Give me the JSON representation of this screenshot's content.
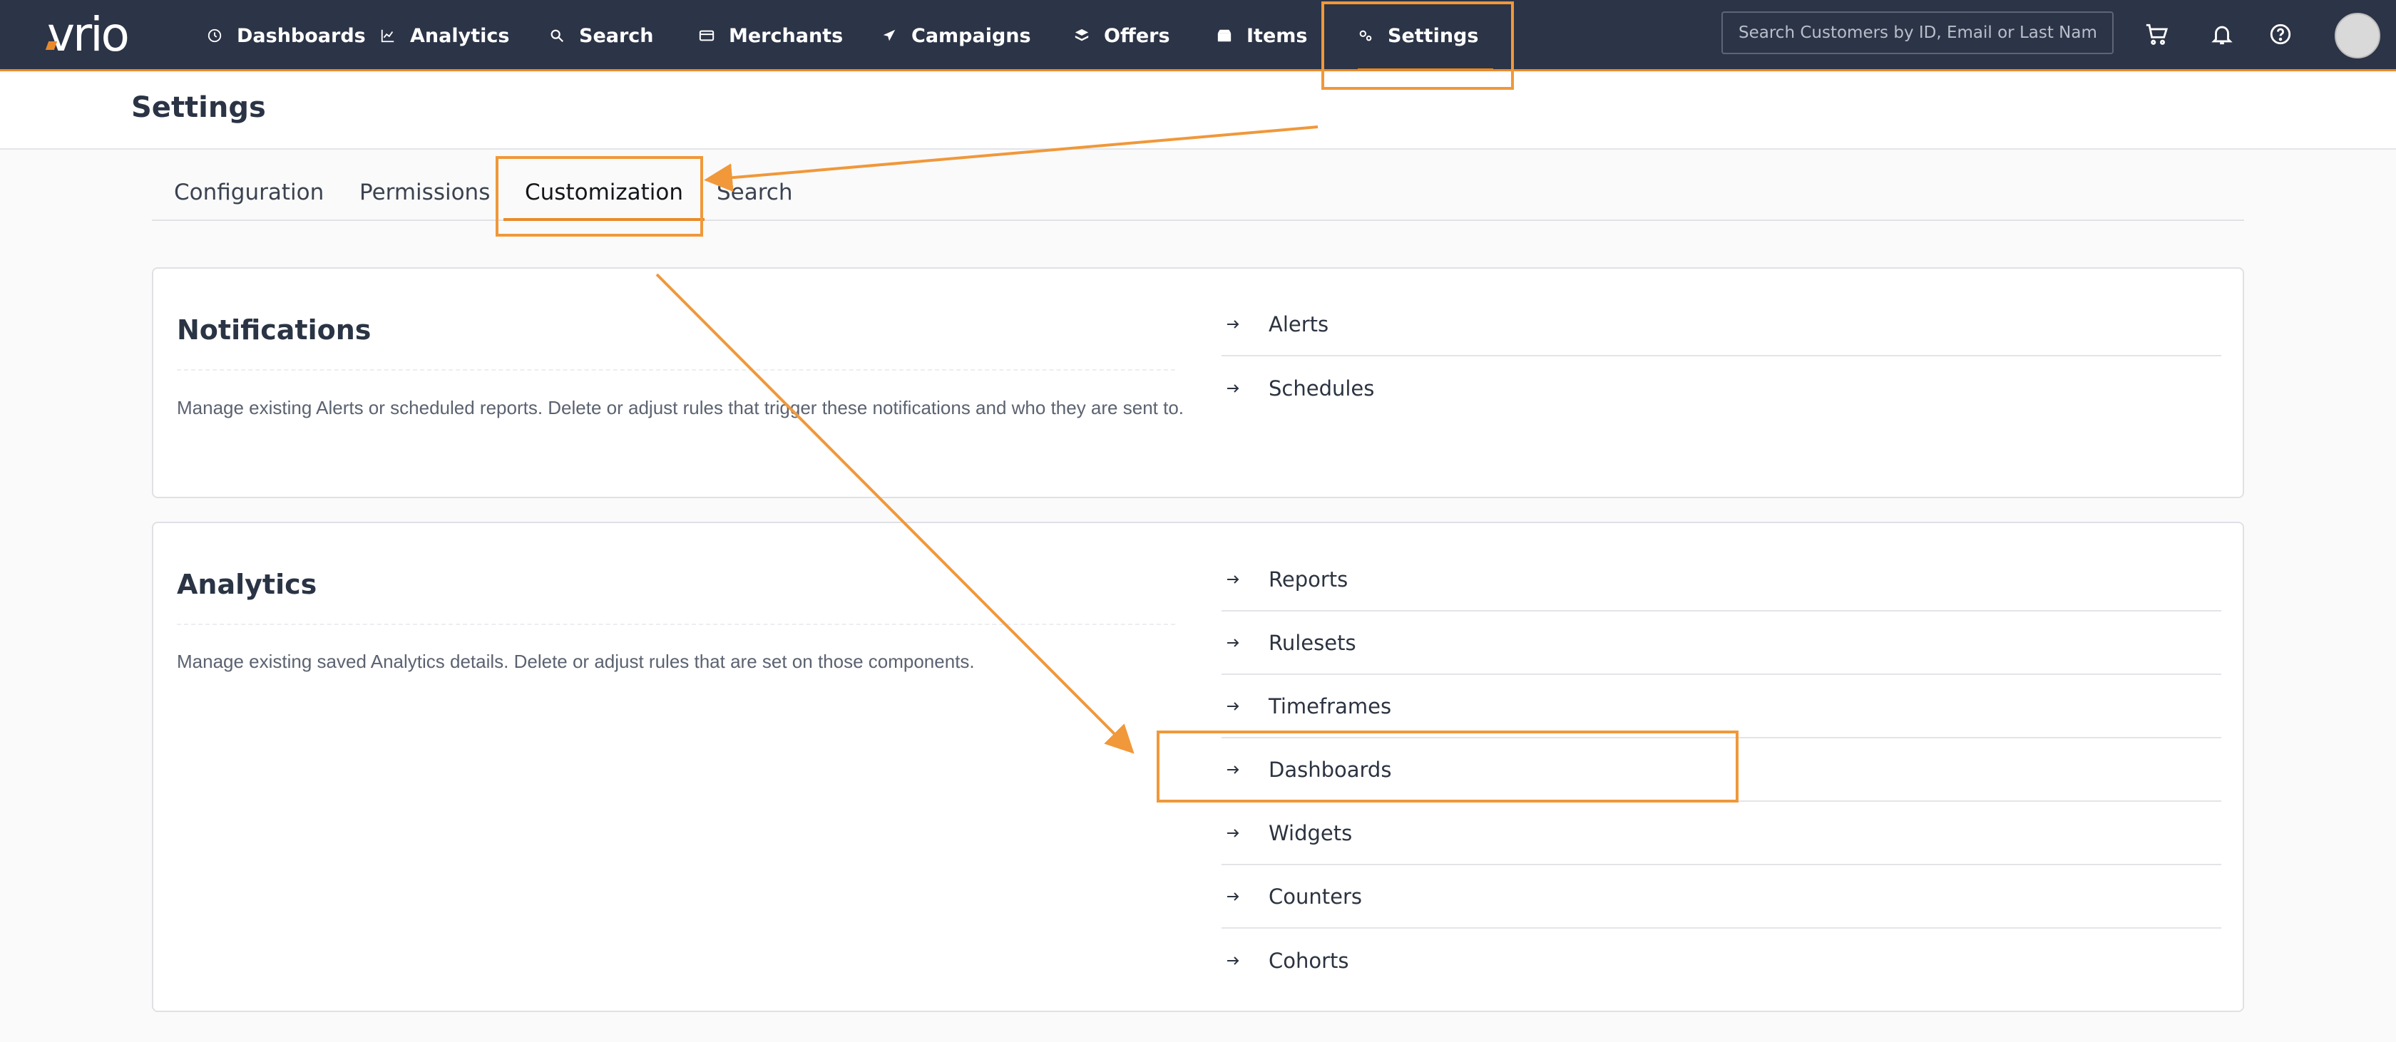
{
  "app": {
    "logo_text": "vrio"
  },
  "nav": {
    "items": [
      {
        "label": "Dashboards",
        "icon": "dashboard-icon"
      },
      {
        "label": "Analytics",
        "icon": "chart-icon"
      },
      {
        "label": "Search",
        "icon": "search-icon"
      },
      {
        "label": "Merchants",
        "icon": "credit-card-icon"
      },
      {
        "label": "Campaigns",
        "icon": "paper-plane-icon"
      },
      {
        "label": "Offers",
        "icon": "layers-icon"
      },
      {
        "label": "Items",
        "icon": "box-icon"
      },
      {
        "label": "Settings",
        "icon": "gear-icon",
        "active": true
      }
    ],
    "search_placeholder": "Search Customers by ID, Email or Last Name"
  },
  "page": {
    "title": "Settings"
  },
  "tabs": {
    "items": [
      {
        "label": "Configuration"
      },
      {
        "label": "Permissions"
      },
      {
        "label": "Customization",
        "active": true
      },
      {
        "label": "Search"
      }
    ]
  },
  "notifications": {
    "title": "Notifications",
    "description": "Manage existing Alerts or scheduled reports. Delete or adjust rules that trigger these notifications and who they are sent to.",
    "links": [
      "Alerts",
      "Schedules"
    ]
  },
  "analytics": {
    "title": "Analytics",
    "description": "Manage existing saved Analytics details. Delete or adjust rules that are set on those components.",
    "links": [
      "Reports",
      "Rulesets",
      "Timeframes",
      "Dashboards",
      "Widgets",
      "Counters",
      "Cohorts"
    ]
  },
  "colors": {
    "nav_bg": "#2c3447",
    "accent": "#e98a2a",
    "annotation": "#f0983a"
  }
}
